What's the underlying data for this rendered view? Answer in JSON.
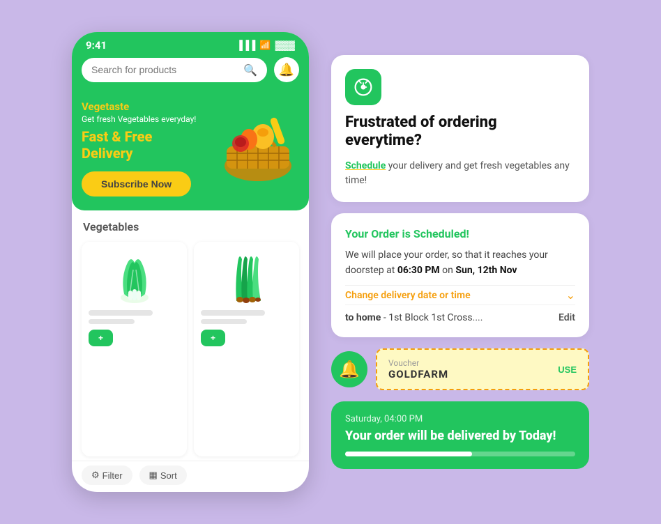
{
  "phone": {
    "status_time": "9:41",
    "search_placeholder": "Search for products",
    "banner": {
      "brand": "Vegetaste",
      "subtitle": "Get fresh Vegetables everyday!",
      "title": "Fast & Free Delivery",
      "subscribe_btn": "Subscribe Now"
    },
    "section_title": "Vegetables",
    "bottom_bar": {
      "filter": "Filter",
      "sort": "Sort"
    }
  },
  "right": {
    "card1": {
      "headline": "Frustrated of ordering everytime?",
      "body_prefix": " your delivery and get fresh vegetables any time!",
      "highlight": "Schedule"
    },
    "card2": {
      "title": "Your Order is Scheduled!",
      "body_prefix": "We will place your order, so that it reaches your doorstep at ",
      "time": "06:30 PM",
      "on_label": " on ",
      "date": "Sun, 12th Nov",
      "change_label": "Change delivery date or time",
      "address_label": "to home",
      "address_value": "- 1st Block 1st Cross....",
      "edit_label": "Edit"
    },
    "voucher": {
      "label": "Voucher",
      "code": "GOLDFARM",
      "use_btn": "USE"
    },
    "delivery": {
      "time": "Saturday, 04:00 PM",
      "message": "Your order will be delivered by Today!",
      "progress": 55
    }
  }
}
